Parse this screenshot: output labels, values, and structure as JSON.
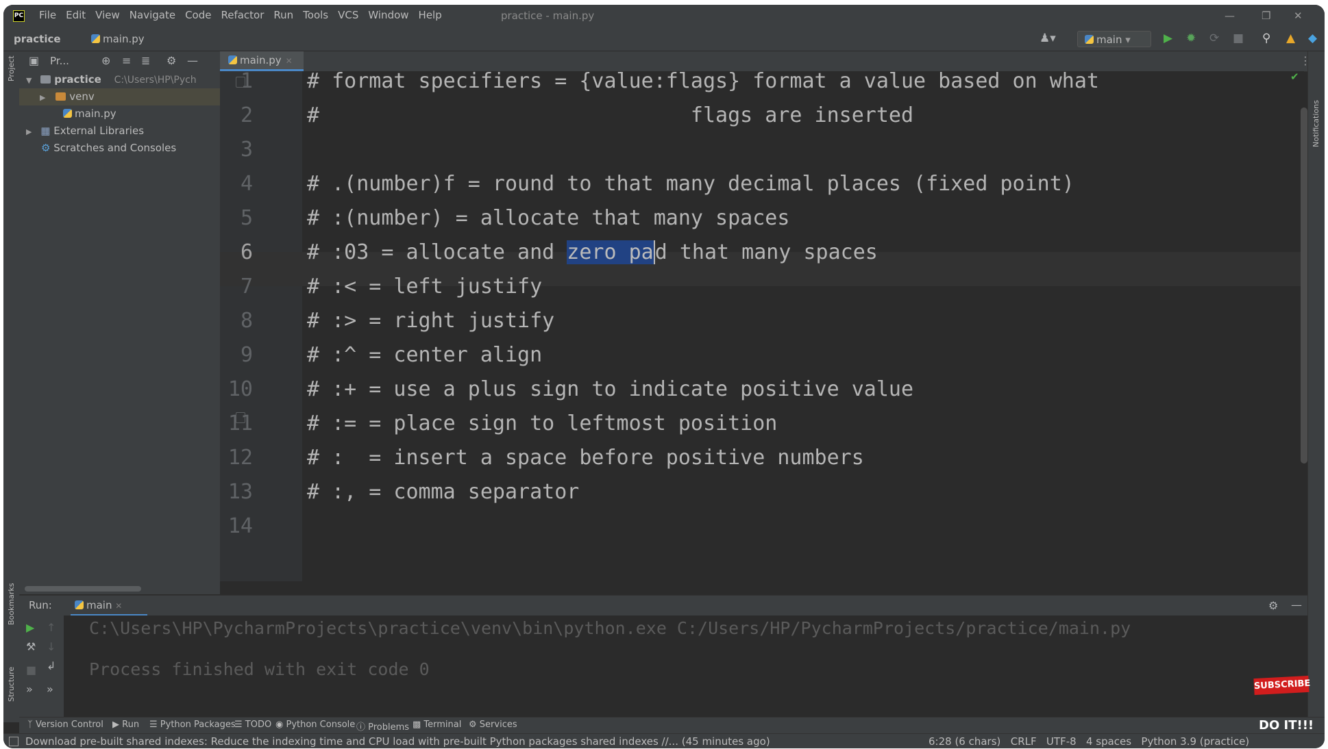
{
  "window": {
    "title": "practice - main.py",
    "menu": [
      "File",
      "Edit",
      "View",
      "Navigate",
      "Code",
      "Refactor",
      "Run",
      "Tools",
      "VCS",
      "Window",
      "Help"
    ]
  },
  "navbar": {
    "project": "practice",
    "file": "main.py",
    "run_config": "main"
  },
  "project_panel": {
    "title": "Pr...",
    "tree": [
      {
        "label": "practice",
        "path": "C:\\Users\\HP\\Pych"
      },
      {
        "label": "venv"
      },
      {
        "label": "main.py"
      },
      {
        "label": "External Libraries"
      },
      {
        "label": "Scratches and Consoles"
      }
    ]
  },
  "left_strip": {
    "project": "Project",
    "bookmarks": "Bookmarks",
    "structure": "Structure"
  },
  "right_strip": {
    "notifications": "Notifications"
  },
  "editor": {
    "tab": "main.py",
    "caret_line": "6",
    "lines": [
      {
        "n": "1",
        "text": "# format specifiers = {value:flags} format a value based on what"
      },
      {
        "n": "2",
        "text": "#                              flags are inserted"
      },
      {
        "n": "3",
        "text": ""
      },
      {
        "n": "4",
        "text": "# .(number)f = round to that many decimal places (fixed point)"
      },
      {
        "n": "5",
        "text": "# :(number) = allocate that many spaces"
      },
      {
        "n": "6",
        "pre": "# :03 = allocate and ",
        "sel": "zero pa",
        "post": "d that many spaces"
      },
      {
        "n": "7",
        "text": "# :< = left justify"
      },
      {
        "n": "8",
        "text": "# :> = right justify"
      },
      {
        "n": "9",
        "text": "# :^ = center align"
      },
      {
        "n": "10",
        "text": "# :+ = use a plus sign to indicate positive value"
      },
      {
        "n": "11",
        "text": "# := = place sign to leftmost position"
      },
      {
        "n": "12",
        "text": "# :  = insert a space before positive numbers"
      },
      {
        "n": "13",
        "text": "# :, = comma separator"
      },
      {
        "n": "14",
        "text": ""
      }
    ]
  },
  "run_panel": {
    "label": "Run:",
    "tab": "main",
    "output": [
      "C:\\Users\\HP\\PycharmProjects\\practice\\venv\\bin\\python.exe C:/Users/HP/PycharmProjects/practice/main.py",
      "Process finished with exit code 0"
    ]
  },
  "bottom_tools": [
    "Version Control",
    "Run",
    "Python Packages",
    "TODO",
    "Python Console",
    "Problems",
    "Terminal",
    "Services"
  ],
  "status": {
    "message": "Download pre-built shared indexes: Reduce the indexing time and CPU load with pre-built Python packages shared indexes //... (45 minutes ago)",
    "position": "6:28 (6 chars)",
    "line_sep": "CRLF",
    "encoding": "UTF-8",
    "indent": "4 spaces",
    "interpreter": "Python 3.9 (practice)"
  },
  "overlay": {
    "subscribe": "SUBSCRIBE",
    "doit": "DO IT!!!"
  }
}
